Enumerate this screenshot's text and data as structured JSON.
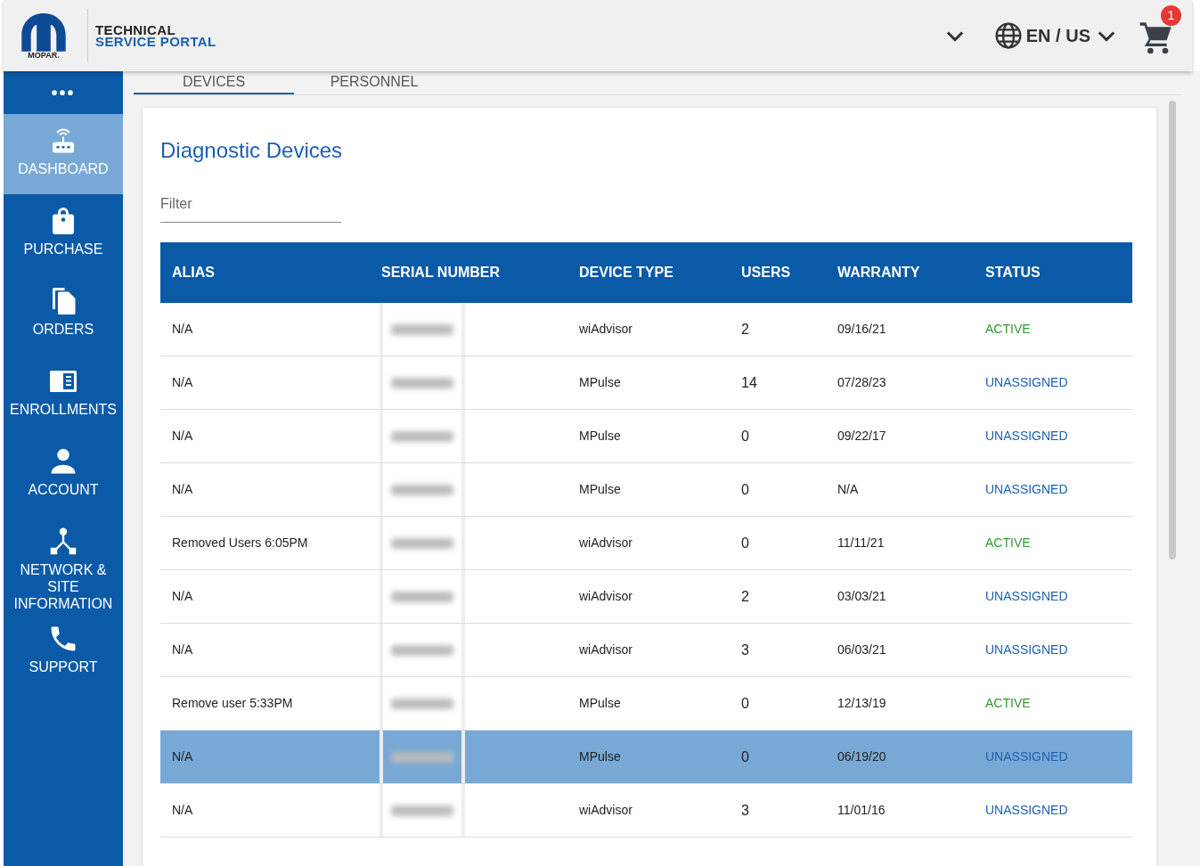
{
  "header": {
    "logo_text": "MOPAR.",
    "portal_title_1": "TECHNICAL",
    "portal_title_2": "SERVICE PORTAL",
    "language": "EN / US",
    "cart_count": "1"
  },
  "sidebar": {
    "menu": "•••",
    "items": [
      {
        "label": "DASHBOARD",
        "selected": true
      },
      {
        "label": "PURCHASE",
        "selected": false
      },
      {
        "label": "ORDERS",
        "selected": false
      },
      {
        "label": "ENROLLMENTS",
        "selected": false
      },
      {
        "label": "ACCOUNT",
        "selected": false
      },
      {
        "label": "NETWORK & SITE INFORMATION",
        "selected": false
      },
      {
        "label": "SUPPORT",
        "selected": false
      }
    ]
  },
  "tabs": [
    {
      "label": "DEVICES",
      "selected": true
    },
    {
      "label": "PERSONNEL",
      "selected": false
    }
  ],
  "card": {
    "title": "Diagnostic Devices",
    "filter": {
      "placeholder": "Filter"
    }
  },
  "table": {
    "columns": [
      "ALIAS",
      "SERIAL NUMBER",
      "DEVICE TYPE",
      "USERS",
      "WARRANTY",
      "STATUS"
    ],
    "rows": [
      {
        "alias": "N/A",
        "device_type": "wiAdvisor",
        "users": "2",
        "warranty": "09/16/21",
        "status": "ACTIVE",
        "color": "#2e9b2e",
        "selected": false
      },
      {
        "alias": "N/A",
        "device_type": "MPulse",
        "users": "14",
        "warranty": "07/28/23",
        "status": "UNASSIGNED",
        "color": "#1c5fb0",
        "selected": false
      },
      {
        "alias": "N/A",
        "device_type": "MPulse",
        "users": "0",
        "warranty": "09/22/17",
        "status": "UNASSIGNED",
        "color": "#1c5fb0",
        "selected": false
      },
      {
        "alias": "N/A",
        "device_type": "MPulse",
        "users": "0",
        "warranty": "N/A",
        "status": "UNASSIGNED",
        "color": "#1c5fb0",
        "selected": false
      },
      {
        "alias": "Removed Users 6:05PM",
        "device_type": "wiAdvisor",
        "users": "0",
        "warranty": "11/11/21",
        "status": "ACTIVE",
        "color": "#2e9b2e",
        "selected": false
      },
      {
        "alias": "N/A",
        "device_type": "wiAdvisor",
        "users": "2",
        "warranty": "03/03/21",
        "status": "UNASSIGNED",
        "color": "#1c5fb0",
        "selected": false
      },
      {
        "alias": "N/A",
        "device_type": "wiAdvisor",
        "users": "3",
        "warranty": "06/03/21",
        "status": "UNASSIGNED",
        "color": "#1c5fb0",
        "selected": false
      },
      {
        "alias": "Remove user 5:33PM",
        "device_type": "MPulse",
        "users": "0",
        "warranty": "12/13/19",
        "status": "ACTIVE",
        "color": "#2e9b2e",
        "selected": false
      },
      {
        "alias": "N/A",
        "device_type": "MPulse",
        "users": "0",
        "warranty": "06/19/20",
        "status": "UNASSIGNED",
        "color": "#1c5fb0",
        "selected": true
      },
      {
        "alias": "N/A",
        "device_type": "wiAdvisor",
        "users": "3",
        "warranty": "11/01/16",
        "status": "UNASSIGNED",
        "color": "#1c5fb0",
        "selected": false
      }
    ]
  }
}
